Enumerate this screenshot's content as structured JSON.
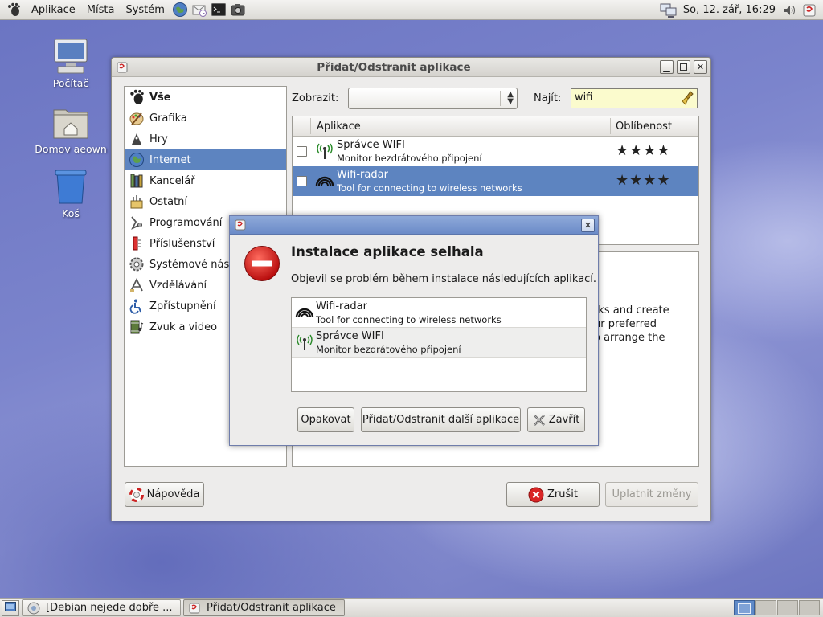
{
  "top_panel": {
    "menus": [
      "Aplikace",
      "Místa",
      "Systém"
    ],
    "clock": "So, 12. zář, 16:29"
  },
  "desktop": {
    "icons": [
      "Počítač",
      "Domov aeown",
      "Koš"
    ]
  },
  "window": {
    "title": "Přidat/Odstranit aplikace",
    "categories": [
      "Vše",
      "Grafika",
      "Hry",
      "Internet",
      "Kancelář",
      "Ostatní",
      "Programování",
      "Příslušenství",
      "Systémové nást",
      "Vzdělávání",
      "Zpřístupnění",
      "Zvuk a video"
    ],
    "selected_category": "Internet",
    "show_label": "Zobrazit:",
    "show_value": "",
    "find_label": "Najít:",
    "search_value": "wifi",
    "columns": [
      "Aplikace",
      "Oblíbenost"
    ],
    "apps": [
      {
        "name": "Správce WIFI",
        "desc": "Monitor bezdrátového připojení",
        "stars": "★★★★",
        "rating": 4,
        "selected": false
      },
      {
        "name": "Wifi-radar",
        "desc": "Tool for connecting to wireless networks",
        "stars": "★★★★",
        "rating": 4,
        "selected": true
      }
    ],
    "description_lines": [
      "rks and create",
      "ur preferred",
      "o arrange the"
    ],
    "help_button": "Nápověda",
    "cancel_button": "Zrušit",
    "apply_button": "Uplatnit změny"
  },
  "dialog": {
    "heading": "Instalace aplikace selhala",
    "message": "Objevil se problém během instalace následujících aplikací.",
    "failed": [
      {
        "name": "Wifi-radar",
        "desc": "Tool for connecting to wireless networks"
      },
      {
        "name": "Správce WIFI",
        "desc": "Monitor bezdrátového připojení"
      }
    ],
    "retry_button": "Opakovat",
    "more_button": "Přidat/Odstranit další aplikace",
    "close_button": "Zavřít"
  },
  "taskbar": {
    "tasks": [
      "[Debian nejede dobře ...",
      "Přidat/Odstranit aplikace"
    ]
  }
}
